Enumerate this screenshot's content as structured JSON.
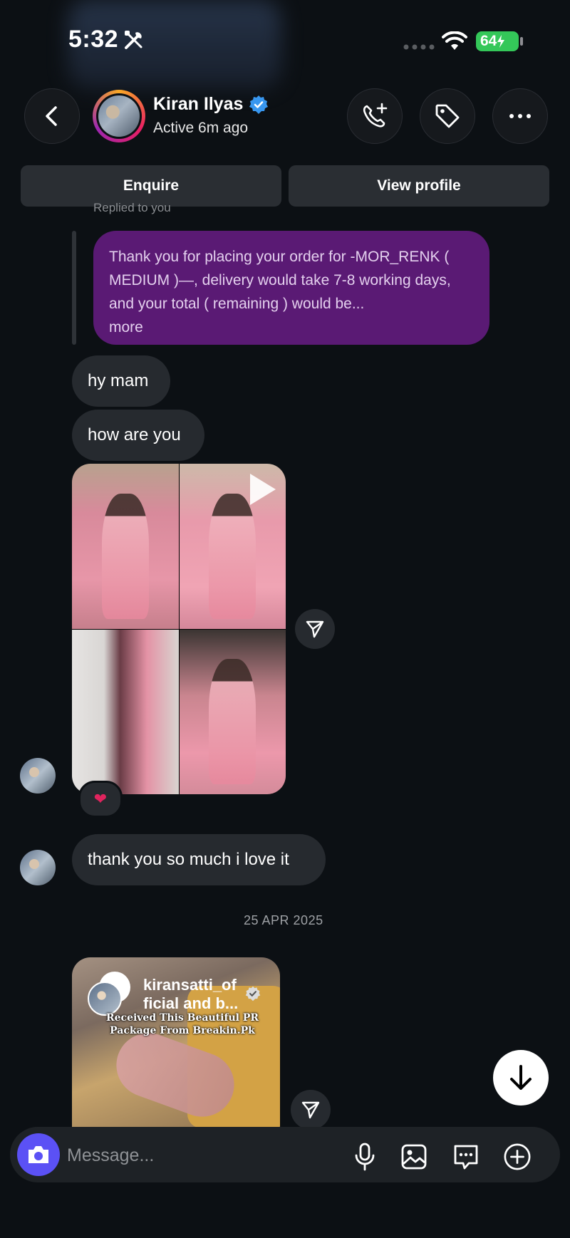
{
  "status_bar": {
    "time": "5:32",
    "battery": "64"
  },
  "header": {
    "name": "Kiran Ilyas",
    "status": "Active 6m ago"
  },
  "actions": {
    "enquire": "Enquire",
    "view_profile": "View profile"
  },
  "thread": {
    "replied_label": "Replied to you",
    "reply_text": "Thank you for placing your order for -MOR_RENK ( MEDIUM )—, delivery would take 7-8 working days, and your total ( remaining ) would be...",
    "reply_more": "more",
    "messages": [
      "hy mam",
      "how are you",
      "thank you so much i love it"
    ],
    "reaction": "❤",
    "date_divider": "25 APR 2025",
    "shared_post": {
      "username_line1": "kiransatti_of",
      "username_line2": "ficial and b...",
      "caption": "Received This Beautiful PR Package From Breakin.Pk"
    }
  },
  "composer": {
    "placeholder": "Message..."
  },
  "colors": {
    "background": "#0c1014",
    "reply_bubble": "#5a1a74",
    "bubble": "#262a2f",
    "camera_button": "#5b51f5",
    "verified": "#3897f0"
  }
}
